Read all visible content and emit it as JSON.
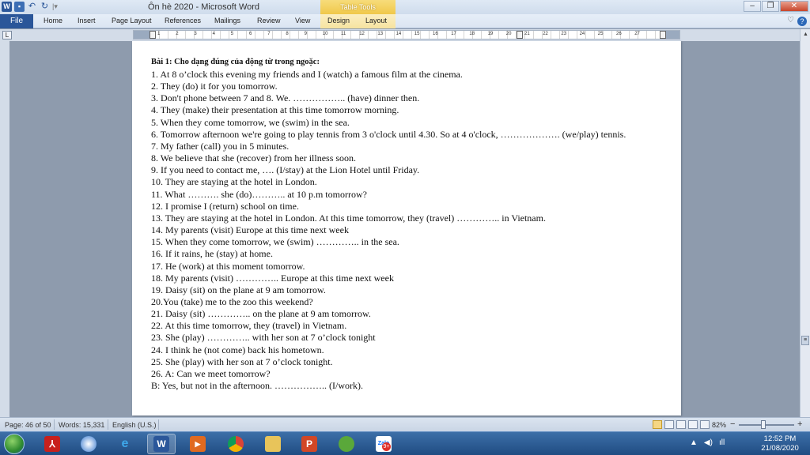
{
  "window": {
    "title": "Ôn hè 2020  -  Microsoft Word",
    "context_tab": "Table Tools",
    "controls": {
      "minimize": "–",
      "restore": "❐",
      "close": "✕"
    }
  },
  "qat": {
    "sep": "|▾"
  },
  "ribbon": {
    "file_label": "File",
    "tabs": [
      "Home",
      "Insert",
      "Page Layout",
      "References",
      "Mailings",
      "Review",
      "View",
      "Design",
      "Layout"
    ],
    "help": "?"
  },
  "ruler": {
    "numbers": [
      "1",
      "2",
      "3",
      "4",
      "5",
      "6",
      "7",
      "8",
      "9",
      "10",
      "11",
      "12",
      "13",
      "14",
      "15",
      "16",
      "17",
      "18",
      "19",
      "20",
      "21",
      "22",
      "23",
      "24",
      "25",
      "26",
      "27"
    ]
  },
  "document": {
    "heading": "Bài 1: Cho dạng đúng của động từ trong ngoặc:",
    "lines": [
      "1. At 8 o’clock this evening my friends and I (watch) a famous film at the cinema.",
      "2. They (do) it for you tomorrow.",
      "3. Don't phone between 7 and 8. We. …………….. (have) dinner then.",
      "4. They (make) their presentation at this time tomorrow morning.",
      "5. When they come tomorrow, we (swim) in the sea.",
      "6. Tomorrow afternoon we're going to play tennis from 3 o'clock until 4.30. So at 4 o'clock, ………………. (we/play) tennis.",
      "7. My father (call) you in 5 minutes.",
      "8. We believe that she (recover) from her illness soon.",
      "9. If you need to contact me, …. (I/stay) at the Lion Hotel until Friday.",
      "10.  They are staying at the hotel in London.",
      "11. What ………. she (do)……….. at 10 p.m tomorrow?",
      "12. I promise I (return) school on time.",
      "13. They are staying at the hotel in London. At this time tomorrow, they (travel) …………..  in Vietnam.",
      "14. My parents (visit) Europe at this time next week",
      "15. When they come tomorrow, we (swim) …………..  in the sea.",
      "16. If it rains, he (stay) at home.",
      "17. He (work) at this moment tomorrow.",
      "18. My parents (visit) …………..  Europe at this time next week",
      "19. Daisy (sit) on the plane at 9 am tomorrow.",
      "20.You (take) me to the zoo this weekend?",
      "21. Daisy (sit) …………..  on the plane at 9 am tomorrow.",
      "22. At this time tomorrow, they (travel) in Vietnam.",
      "23. She (play) …………..  with her son at 7 o’clock tonight",
      "24. I think he (not come) back his hometown.",
      "25. She (play) with her son at 7 o’clock tonight.",
      "26. A: Can we meet tomorrow?",
      "B: Yes, but not in the afternoon. …………….. (I/work)."
    ]
  },
  "statusbar": {
    "page": "Page: 46 of 50",
    "words": "Words: 15,331",
    "language": "English (U.S.)",
    "zoom": "82%",
    "zoom_minus": "−",
    "zoom_plus": "+"
  },
  "taskbar": {
    "tray": [
      "▲",
      "◀)",
      "ıll"
    ],
    "time": "12:52 PM",
    "date": "21/08/2020",
    "zalo_label": "Zalo",
    "zalo_badge": "9+"
  }
}
